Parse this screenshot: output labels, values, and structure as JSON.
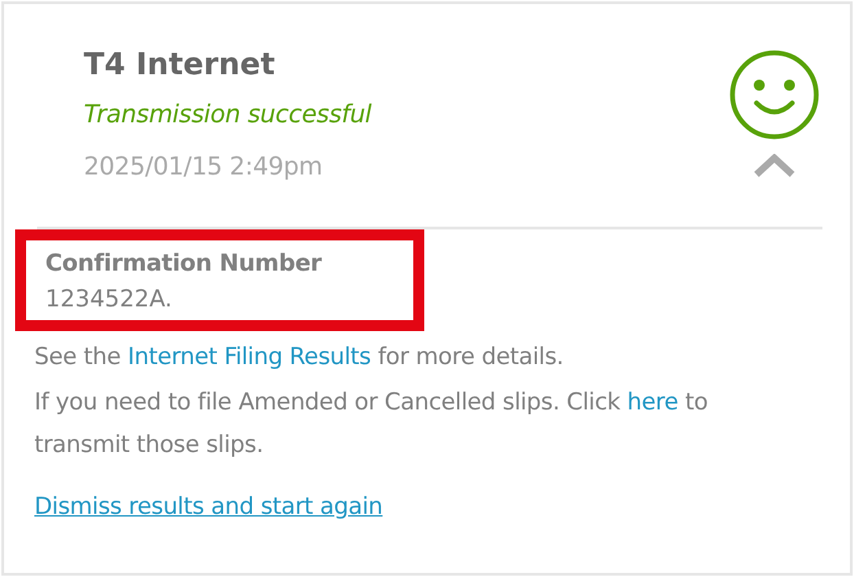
{
  "header": {
    "title": "T4 Internet",
    "status": {
      "text": "Transmission successful",
      "kind": "success"
    },
    "timestamp": "2025/01/15 2:49pm",
    "expanded": true
  },
  "confirmation": {
    "label": "Confirmation Number",
    "value": "1234522A.",
    "highlighted": true
  },
  "details_line": {
    "before": "See the ",
    "link": "Internet Filing Results",
    "after": " for more details."
  },
  "amend_line": {
    "before": "If you need to file Amended or Cancelled slips. Click ",
    "link": "here",
    "after": " to transmit those slips."
  },
  "dismiss_link": "Dismiss results and start again"
}
